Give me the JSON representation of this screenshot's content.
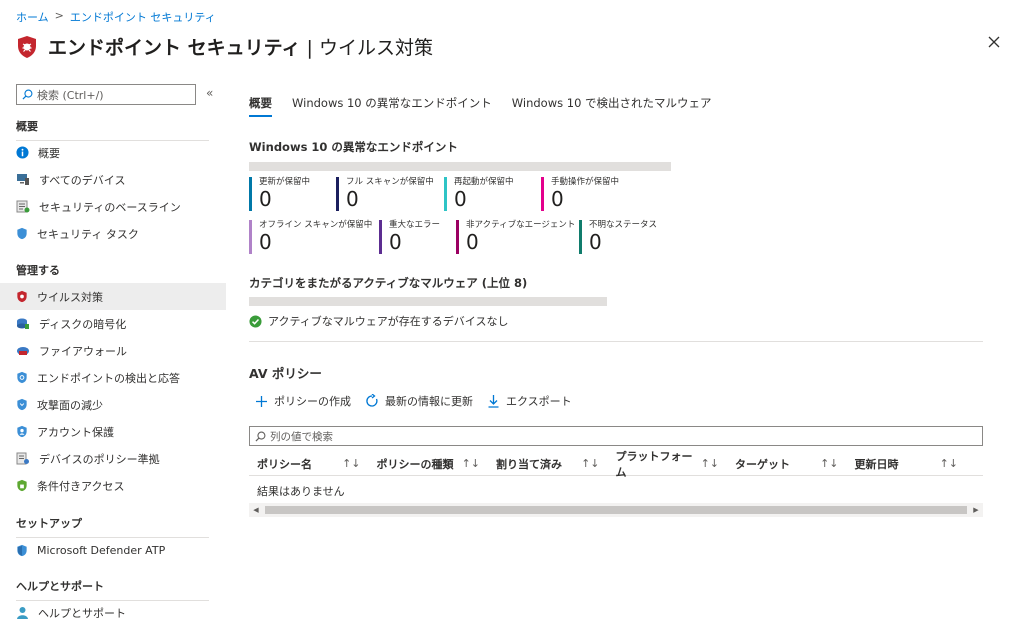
{
  "breadcrumb": {
    "home": "ホーム",
    "section": "エンドポイント セキュリティ"
  },
  "title": {
    "main": "エンドポイント セキュリティ",
    "sub": " | ウイルス対策"
  },
  "sidebar": {
    "search_placeholder": "検索 (Ctrl+/)",
    "sections": {
      "overview": "概要",
      "manage": "管理する",
      "setup": "セットアップ",
      "help": "ヘルプとサポート"
    },
    "items": [
      "概要",
      "すべてのデバイス",
      "セキュリティのベースライン",
      "セキュリティ タスク",
      "ウイルス対策",
      "ディスクの暗号化",
      "ファイアウォール",
      "エンドポイントの検出と応答",
      "攻撃面の減少",
      "アカウント保護",
      "デバイスのポリシー準拠",
      "条件付きアクセス",
      "Microsoft Defender ATP",
      "ヘルプとサポート"
    ]
  },
  "tabs": [
    "概要",
    "Windows 10 の異常なエンドポイント",
    "Windows 10 で検出されたマルウェア"
  ],
  "unhealthy": {
    "heading": "Windows 10 の異常なエンドポイント",
    "stats": [
      {
        "label": "更新が保留中",
        "value": "0",
        "color": "#0078a8"
      },
      {
        "label": "フル スキャンが保留中",
        "value": "0",
        "color": "#1b1f5e"
      },
      {
        "label": "再起動が保留中",
        "value": "0",
        "color": "#2ec4c6"
      },
      {
        "label": "手動操作が保留中",
        "value": "0",
        "color": "#e3008c"
      },
      {
        "label": "オフライン スキャンが保留中",
        "value": "0",
        "color": "#b082c8"
      },
      {
        "label": "重大なエラー",
        "value": "0",
        "color": "#5c2d91"
      },
      {
        "label": "非アクティブなエージェント",
        "value": "0",
        "color": "#9b0062"
      },
      {
        "label": "不明なステータス",
        "value": "0",
        "color": "#107c6c"
      }
    ]
  },
  "malware": {
    "heading": "カテゴリをまたがるアクティブなマルウェア (上位 8)",
    "ok_text": "アクティブなマルウェアが存在するデバイスなし"
  },
  "av_policy": {
    "heading": "AV ポリシー",
    "toolbar": {
      "create": "ポリシーの作成",
      "refresh": "最新の情報に更新",
      "export": "エクスポート"
    },
    "filter_placeholder": "列の値で検索",
    "columns": [
      "ポリシー名",
      "ポリシーの種類",
      "割り当て済み",
      "プラットフォーム",
      "ターゲット",
      "更新日時"
    ],
    "sort_glyph": "↑↓",
    "empty_text": "結果はありません"
  }
}
